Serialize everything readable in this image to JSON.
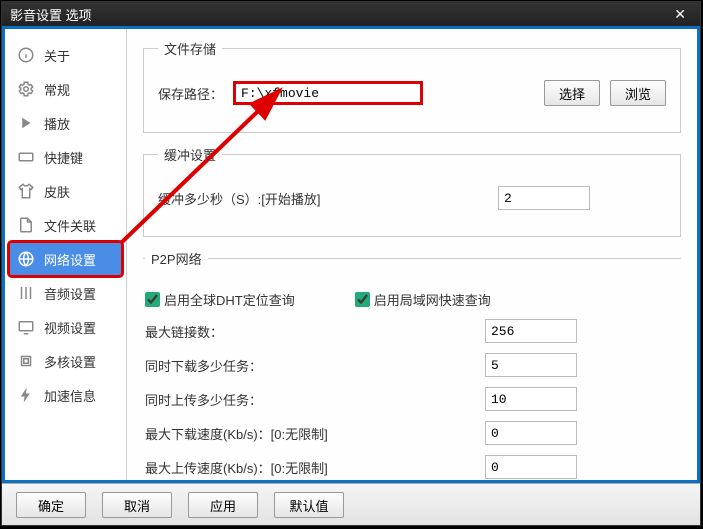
{
  "title": "影音设置 选项",
  "sidebar": {
    "items": [
      {
        "label": "关于"
      },
      {
        "label": "常规"
      },
      {
        "label": "播放"
      },
      {
        "label": "快捷键"
      },
      {
        "label": "皮肤"
      },
      {
        "label": "文件关联"
      },
      {
        "label": "网络设置"
      },
      {
        "label": "音频设置"
      },
      {
        "label": "视频设置"
      },
      {
        "label": "多核设置"
      },
      {
        "label": "加速信息"
      }
    ],
    "activeIndex": 6
  },
  "storage": {
    "legend": "文件存储",
    "pathLabel": "保存路径：",
    "pathValue": "F:\\xfmovie",
    "selectBtn": "选择",
    "browseBtn": "浏览"
  },
  "buffer": {
    "legend": "缓冲设置",
    "label": "缓冲多少秒（S）:[开始播放]",
    "value": "2"
  },
  "p2p": {
    "legend": "P2P网络",
    "dhtLabel": "启用全球DHT定位查询",
    "dhtChecked": true,
    "lanLabel": "启用局域网快速查询",
    "lanChecked": true,
    "maxConnLabel": "最大链接数：",
    "maxConnValue": "256",
    "dlTasksLabel": "同时下载多少任务：",
    "dlTasksValue": "5",
    "ulTasksLabel": "同时上传多少任务：",
    "ulTasksValue": "10",
    "maxDlLabel": "最大下载速度(Kb/s)：[0:无限制]",
    "maxDlValue": "0",
    "maxUlLabel": "最大上传速度(Kb/s)：[0:无限制]",
    "maxUlValue": "0"
  },
  "footer": {
    "ok": "确定",
    "cancel": "取消",
    "apply": "应用",
    "defaults": "默认值"
  }
}
